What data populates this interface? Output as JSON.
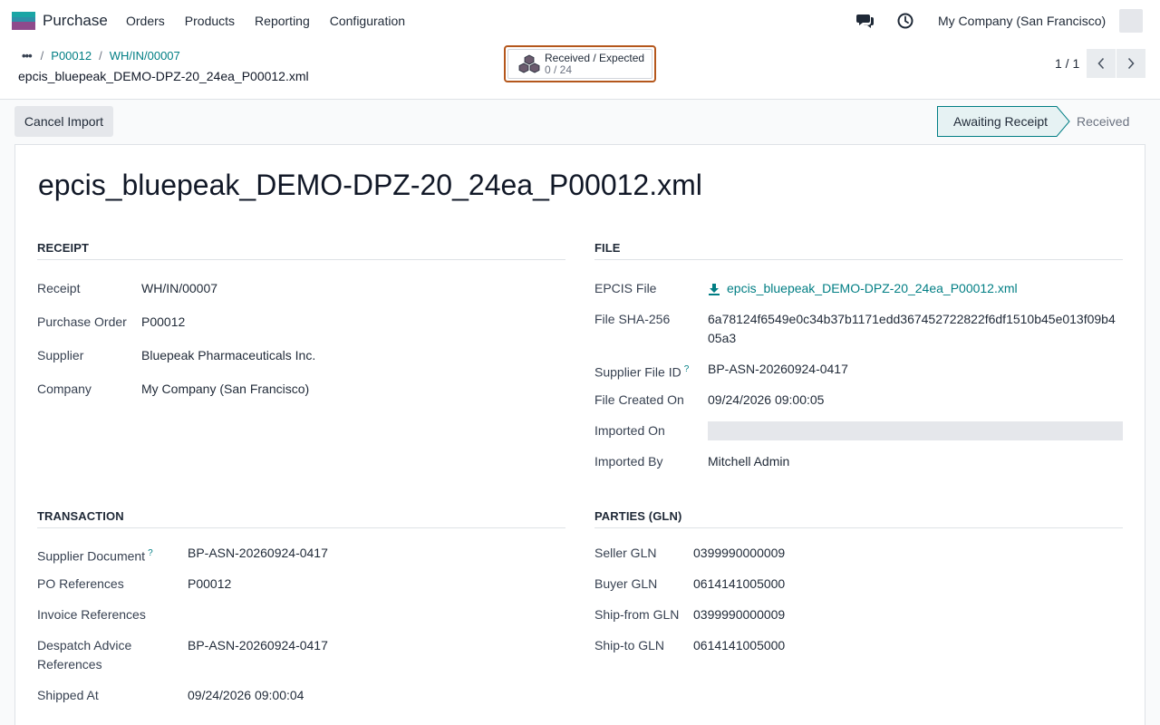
{
  "app": {
    "name": "Purchase"
  },
  "menu": [
    {
      "label": "Orders"
    },
    {
      "label": "Products"
    },
    {
      "label": "Reporting"
    },
    {
      "label": "Configuration"
    }
  ],
  "systray": {
    "company": "My Company (San Francisco)"
  },
  "breadcrumb": {
    "dots": "•••",
    "items": [
      "P00012",
      "WH/IN/00007"
    ]
  },
  "record_title": "epcis_bluepeak_DEMO-DPZ-20_24ea_P00012.xml",
  "smart_button": {
    "label": "Received / Expected",
    "value": "0 / 24"
  },
  "pager": {
    "value": "1 / 1"
  },
  "status": {
    "cancel_label": "Cancel Import",
    "stages": [
      "Awaiting Receipt",
      "Received"
    ],
    "active": "Awaiting Receipt"
  },
  "sheet": {
    "title": "epcis_bluepeak_DEMO-DPZ-20_24ea_P00012.xml",
    "receipt": {
      "title": "RECEIPT",
      "fields": [
        {
          "label": "Receipt",
          "value": "WH/IN/00007"
        },
        {
          "label": "Purchase Order",
          "value": "P00012"
        },
        {
          "label": "Supplier",
          "value": "Bluepeak Pharmaceuticals Inc."
        },
        {
          "label": "Company",
          "value": "My Company (San Francisco)"
        }
      ]
    },
    "file": {
      "title": "FILE",
      "epcis_label": "EPCIS File",
      "epcis_value": "epcis_bluepeak_DEMO-DPZ-20_24ea_P00012.xml",
      "sha_label": "File SHA-256",
      "sha_line1": "6a78124f6549e0c34b37b1171edd367452722822f6df1510b45e013f09b4",
      "sha_line2": "05a3",
      "supplier_file_label": "Supplier File ID",
      "supplier_file_value": "BP-ASN-20260924-0417",
      "created_label": "File Created On",
      "created_value": "09/24/2026 09:00:05",
      "imported_on_label": "Imported On",
      "imported_by_label": "Imported By",
      "imported_by_value": "Mitchell Admin",
      "help_mark": "?"
    },
    "transaction": {
      "title": "TRANSACTION",
      "supplier_doc_label": "Supplier Document",
      "supplier_doc_value": "BP-ASN-20260924-0417",
      "po_refs_label": "PO References",
      "po_refs_value": "P00012",
      "invoice_refs_label": "Invoice References",
      "despatch_label_1": "Despatch Advice",
      "despatch_label_2": "References",
      "despatch_value": "BP-ASN-20260924-0417",
      "shipped_label": "Shipped At",
      "shipped_value": "09/24/2026 09:00:04",
      "help_mark": "?"
    },
    "parties": {
      "title": "PARTIES (GLN)",
      "fields": [
        {
          "label": "Seller GLN",
          "value": "0399990000009"
        },
        {
          "label": "Buyer GLN",
          "value": "0614141005000"
        },
        {
          "label": "Ship-from GLN",
          "value": "0399990000009"
        },
        {
          "label": "Ship-to GLN",
          "value": "0614141005000"
        }
      ]
    }
  },
  "icons": {
    "chat": "chat-icon",
    "clock": "clock-icon",
    "download": "download-icon",
    "boxes": "boxes-icon"
  },
  "colors": {
    "link": "#017e84",
    "smart_border": "#b4571c",
    "logo_teal": "#1aa5a5",
    "logo_purple": "#8e4a8c"
  }
}
